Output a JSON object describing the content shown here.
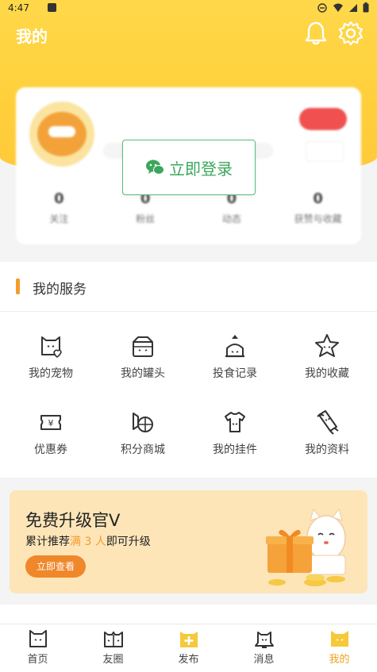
{
  "status_bar": {
    "time": "4:47"
  },
  "header": {
    "title": "我的"
  },
  "icons": {
    "bell": "bell-icon",
    "settings": "gear-icon"
  },
  "login": {
    "label": "立即登录"
  },
  "services": {
    "title": "我的服务",
    "items": [
      {
        "label": "我的宠物",
        "icon": "pet-icon"
      },
      {
        "label": "我的罐头",
        "icon": "can-icon"
      },
      {
        "label": "投食记录",
        "icon": "feed-record-icon"
      },
      {
        "label": "我的收藏",
        "icon": "star-icon"
      },
      {
        "label": "优惠券",
        "icon": "coupon-icon"
      },
      {
        "label": "积分商城",
        "icon": "points-mall-icon"
      },
      {
        "label": "我的挂件",
        "icon": "pendant-icon"
      },
      {
        "label": "我的资料",
        "icon": "profile-icon"
      }
    ]
  },
  "promo": {
    "title": "免费升级官V",
    "subtitle_prefix": "累计推荐",
    "subtitle_highlight": "满 3 人",
    "subtitle_suffix": "即可升级",
    "button": "立即查看"
  },
  "tabs": [
    {
      "label": "首页",
      "icon": "home-cat-icon"
    },
    {
      "label": "友圈",
      "icon": "friends-cat-icon"
    },
    {
      "label": "发布",
      "icon": "publish-plus-icon"
    },
    {
      "label": "消息",
      "icon": "message-cat-icon"
    },
    {
      "label": "我的",
      "icon": "me-cat-icon",
      "active": true
    }
  ],
  "colors": {
    "accent": "#f0a21b",
    "header": "#ffd23f",
    "login_green": "#3aa75c"
  }
}
